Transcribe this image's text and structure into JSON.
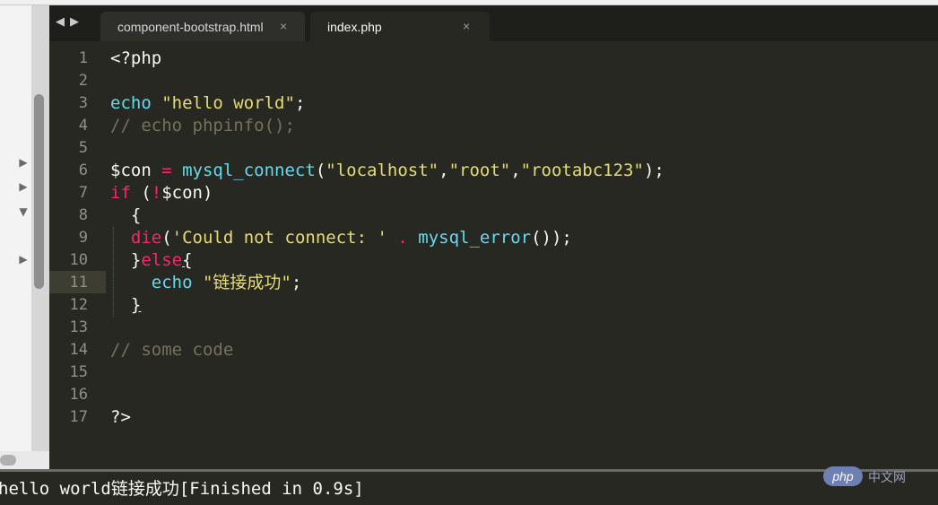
{
  "tabs": [
    {
      "label": "component-bootstrap.html",
      "close": "×"
    },
    {
      "label": "index.php",
      "close": "×"
    }
  ],
  "nav": {
    "back": "◀",
    "forward": "▶"
  },
  "line_numbers": [
    "1",
    "2",
    "3",
    "4",
    "5",
    "6",
    "7",
    "8",
    "9",
    "10",
    "11",
    "12",
    "13",
    "14",
    "15",
    "16",
    "17"
  ],
  "code": {
    "l1": "<?php",
    "l3_kw": "echo",
    "l3_str": "\"hello world\"",
    "l3_end": ";",
    "l4": "// echo phpinfo();",
    "l6_var": "$con",
    "l6_op": " = ",
    "l6_fn": "mysql_connect",
    "l6_p1": "(",
    "l6_s1": "\"localhost\"",
    "l6_c1": ",",
    "l6_s2": "\"root\"",
    "l6_c2": ",",
    "l6_s3": "\"rootabc123\"",
    "l6_end": ");",
    "l7_kw": "if",
    "l7_p": " (",
    "l7_op": "!",
    "l7_rest": "$con)",
    "l8": "  {",
    "l9_ind": "  ",
    "l9_kw": "die",
    "l9_p1": "(",
    "l9_str": "'Could not connect: '",
    "l9_sp": " ",
    "l9_dot": ".",
    "l9_sp2": " ",
    "l9_fn": "mysql_error",
    "l9_end": "());",
    "l10_ind": "  ",
    "l10_br": "}",
    "l10_kw": "else",
    "l10_br2": "{",
    "l11_ind": "    ",
    "l11_kw": "echo",
    "l11_sp": " ",
    "l11_str": "\"链接成功\"",
    "l11_end": ";",
    "l12_ind": "  ",
    "l12_br": "}",
    "l14": "// some code",
    "l17": "?>"
  },
  "output": {
    "text": "hello world链接成功[Finished in 0.9s]"
  },
  "watermark": {
    "logo": "php",
    "text": "中文网"
  },
  "fold_markers": [
    "▶",
    "▶",
    "▼",
    "▶"
  ],
  "colors": {
    "background": "#272822",
    "keyword": "#f92672",
    "function": "#66d9ef",
    "string": "#e6db74",
    "comment": "#75715e",
    "text": "#f8f8f2",
    "line_number": "#8f908a"
  }
}
